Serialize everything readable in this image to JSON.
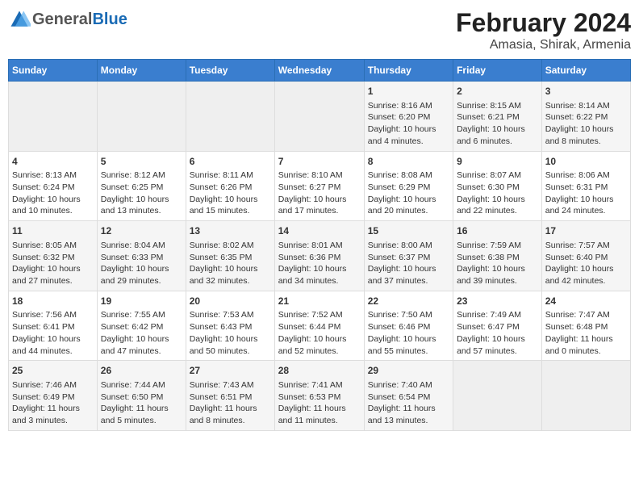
{
  "logo": {
    "general": "General",
    "blue": "Blue"
  },
  "title": "February 2024",
  "subtitle": "Amasia, Shirak, Armenia",
  "weekdays": [
    "Sunday",
    "Monday",
    "Tuesday",
    "Wednesday",
    "Thursday",
    "Friday",
    "Saturday"
  ],
  "weeks": [
    [
      {
        "num": "",
        "info": ""
      },
      {
        "num": "",
        "info": ""
      },
      {
        "num": "",
        "info": ""
      },
      {
        "num": "",
        "info": ""
      },
      {
        "num": "1",
        "info": "Sunrise: 8:16 AM\nSunset: 6:20 PM\nDaylight: 10 hours\nand 4 minutes."
      },
      {
        "num": "2",
        "info": "Sunrise: 8:15 AM\nSunset: 6:21 PM\nDaylight: 10 hours\nand 6 minutes."
      },
      {
        "num": "3",
        "info": "Sunrise: 8:14 AM\nSunset: 6:22 PM\nDaylight: 10 hours\nand 8 minutes."
      }
    ],
    [
      {
        "num": "4",
        "info": "Sunrise: 8:13 AM\nSunset: 6:24 PM\nDaylight: 10 hours\nand 10 minutes."
      },
      {
        "num": "5",
        "info": "Sunrise: 8:12 AM\nSunset: 6:25 PM\nDaylight: 10 hours\nand 13 minutes."
      },
      {
        "num": "6",
        "info": "Sunrise: 8:11 AM\nSunset: 6:26 PM\nDaylight: 10 hours\nand 15 minutes."
      },
      {
        "num": "7",
        "info": "Sunrise: 8:10 AM\nSunset: 6:27 PM\nDaylight: 10 hours\nand 17 minutes."
      },
      {
        "num": "8",
        "info": "Sunrise: 8:08 AM\nSunset: 6:29 PM\nDaylight: 10 hours\nand 20 minutes."
      },
      {
        "num": "9",
        "info": "Sunrise: 8:07 AM\nSunset: 6:30 PM\nDaylight: 10 hours\nand 22 minutes."
      },
      {
        "num": "10",
        "info": "Sunrise: 8:06 AM\nSunset: 6:31 PM\nDaylight: 10 hours\nand 24 minutes."
      }
    ],
    [
      {
        "num": "11",
        "info": "Sunrise: 8:05 AM\nSunset: 6:32 PM\nDaylight: 10 hours\nand 27 minutes."
      },
      {
        "num": "12",
        "info": "Sunrise: 8:04 AM\nSunset: 6:33 PM\nDaylight: 10 hours\nand 29 minutes."
      },
      {
        "num": "13",
        "info": "Sunrise: 8:02 AM\nSunset: 6:35 PM\nDaylight: 10 hours\nand 32 minutes."
      },
      {
        "num": "14",
        "info": "Sunrise: 8:01 AM\nSunset: 6:36 PM\nDaylight: 10 hours\nand 34 minutes."
      },
      {
        "num": "15",
        "info": "Sunrise: 8:00 AM\nSunset: 6:37 PM\nDaylight: 10 hours\nand 37 minutes."
      },
      {
        "num": "16",
        "info": "Sunrise: 7:59 AM\nSunset: 6:38 PM\nDaylight: 10 hours\nand 39 minutes."
      },
      {
        "num": "17",
        "info": "Sunrise: 7:57 AM\nSunset: 6:40 PM\nDaylight: 10 hours\nand 42 minutes."
      }
    ],
    [
      {
        "num": "18",
        "info": "Sunrise: 7:56 AM\nSunset: 6:41 PM\nDaylight: 10 hours\nand 44 minutes."
      },
      {
        "num": "19",
        "info": "Sunrise: 7:55 AM\nSunset: 6:42 PM\nDaylight: 10 hours\nand 47 minutes."
      },
      {
        "num": "20",
        "info": "Sunrise: 7:53 AM\nSunset: 6:43 PM\nDaylight: 10 hours\nand 50 minutes."
      },
      {
        "num": "21",
        "info": "Sunrise: 7:52 AM\nSunset: 6:44 PM\nDaylight: 10 hours\nand 52 minutes."
      },
      {
        "num": "22",
        "info": "Sunrise: 7:50 AM\nSunset: 6:46 PM\nDaylight: 10 hours\nand 55 minutes."
      },
      {
        "num": "23",
        "info": "Sunrise: 7:49 AM\nSunset: 6:47 PM\nDaylight: 10 hours\nand 57 minutes."
      },
      {
        "num": "24",
        "info": "Sunrise: 7:47 AM\nSunset: 6:48 PM\nDaylight: 11 hours\nand 0 minutes."
      }
    ],
    [
      {
        "num": "25",
        "info": "Sunrise: 7:46 AM\nSunset: 6:49 PM\nDaylight: 11 hours\nand 3 minutes."
      },
      {
        "num": "26",
        "info": "Sunrise: 7:44 AM\nSunset: 6:50 PM\nDaylight: 11 hours\nand 5 minutes."
      },
      {
        "num": "27",
        "info": "Sunrise: 7:43 AM\nSunset: 6:51 PM\nDaylight: 11 hours\nand 8 minutes."
      },
      {
        "num": "28",
        "info": "Sunrise: 7:41 AM\nSunset: 6:53 PM\nDaylight: 11 hours\nand 11 minutes."
      },
      {
        "num": "29",
        "info": "Sunrise: 7:40 AM\nSunset: 6:54 PM\nDaylight: 11 hours\nand 13 minutes."
      },
      {
        "num": "",
        "info": ""
      },
      {
        "num": "",
        "info": ""
      }
    ]
  ]
}
